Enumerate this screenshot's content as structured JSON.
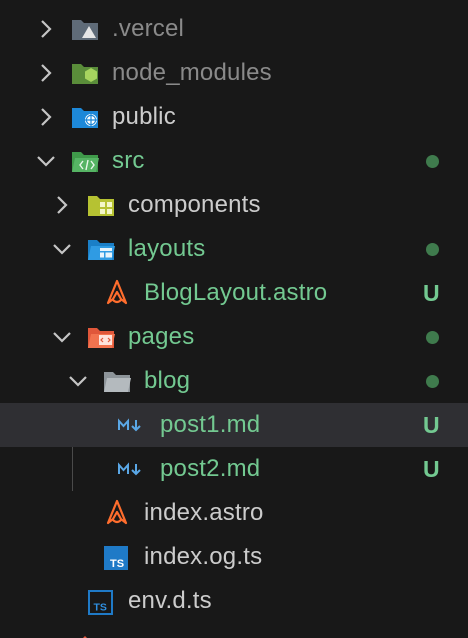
{
  "colors": {
    "background": "#181818",
    "selected_row": "#2f2f33",
    "text_default": "#cccccc",
    "text_untracked": "#73c991",
    "text_ignored": "#8a8a8a",
    "status_dot": "#3f7b4d",
    "status_letter": "#73c991",
    "chevron": "#c5c5c5"
  },
  "tree": {
    "items": [
      {
        "label": ".vercel",
        "icon": "vercel-folder-icon",
        "chevron": "right"
      },
      {
        "label": "node_modules",
        "icon": "node-folder-icon",
        "chevron": "right"
      },
      {
        "label": "public",
        "icon": "public-folder-icon",
        "chevron": "right"
      },
      {
        "label": "src",
        "icon": "src-folder-icon",
        "chevron": "down"
      },
      {
        "label": "components",
        "icon": "components-folder-icon",
        "chevron": "right"
      },
      {
        "label": "layouts",
        "icon": "layouts-folder-icon",
        "chevron": "down"
      },
      {
        "label": "BlogLayout.astro",
        "icon": "astro-file-icon",
        "status": "U"
      },
      {
        "label": "pages",
        "icon": "pages-folder-icon",
        "chevron": "down"
      },
      {
        "label": "blog",
        "icon": "folder-open-icon",
        "chevron": "down"
      },
      {
        "label": "post1.md",
        "icon": "markdown-file-icon",
        "status": "U"
      },
      {
        "label": "post2.md",
        "icon": "markdown-file-icon",
        "status": "U"
      },
      {
        "label": "index.astro",
        "icon": "astro-file-icon"
      },
      {
        "label": "index.og.ts",
        "icon": "typescript-file-icon"
      },
      {
        "label": "env.d.ts",
        "icon": "typescript-file-icon"
      }
    ]
  }
}
